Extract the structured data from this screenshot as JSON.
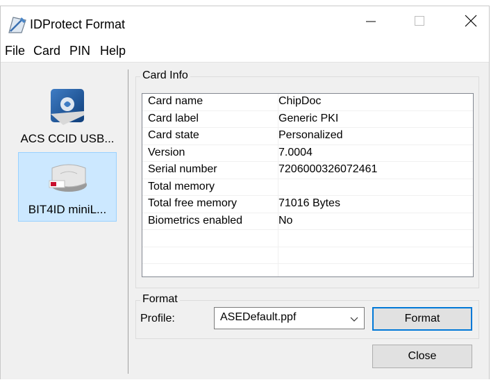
{
  "window": {
    "title": "IDProtect Format",
    "app_icon": "idprotect-format-icon",
    "controls": [
      "minimize-icon",
      "maximize-icon",
      "close-icon"
    ]
  },
  "menu": {
    "items": [
      {
        "label": "File"
      },
      {
        "label": "Card"
      },
      {
        "label": "PIN"
      },
      {
        "label": "Help"
      }
    ]
  },
  "readers": [
    {
      "label": "ACS CCID USB...",
      "icon": "smartcard-reader-icon",
      "selected": false
    },
    {
      "label": "BIT4ID miniL...",
      "icon": "usb-card-reader-icon",
      "selected": true
    }
  ],
  "card_info": {
    "caption": "Card Info",
    "rows": [
      {
        "key": "Card name",
        "value": "ChipDoc"
      },
      {
        "key": "Card label",
        "value": "Generic PKI"
      },
      {
        "key": "Card state",
        "value": "Personalized"
      },
      {
        "key": "Version",
        "value": "7.0004"
      },
      {
        "key": "Serial number",
        "value": "7206000326072461"
      },
      {
        "key": "Total memory",
        "value": ""
      },
      {
        "key": "Total free memory",
        "value": "71016 Bytes"
      },
      {
        "key": "Biometrics enabled",
        "value": "No"
      },
      {
        "key": "",
        "value": ""
      },
      {
        "key": "",
        "value": ""
      },
      {
        "key": "",
        "value": ""
      }
    ]
  },
  "format": {
    "caption": "Format",
    "profile_label": "Profile:",
    "profile_value": "ASEDefault.ppf",
    "format_button": "Format",
    "close_button": "Close"
  },
  "colors": {
    "selection_bg": "#cce8ff",
    "selection_border": "#99d1ff",
    "default_button_border": "#0078d7",
    "dialog_bg": "#f0f0f0"
  }
}
